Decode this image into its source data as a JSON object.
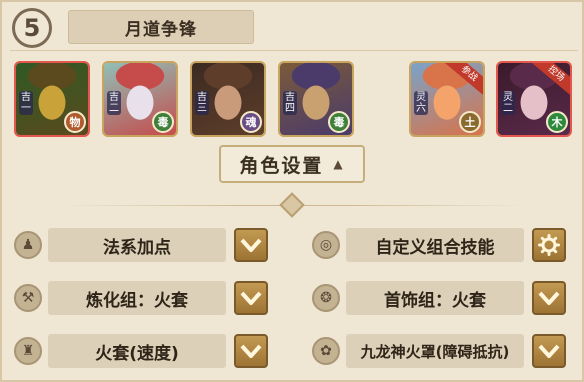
{
  "header": {
    "step_number": "5",
    "title": "月道争锋"
  },
  "heroes": [
    {
      "tag": "吉一",
      "element": "物",
      "element_color": "#b15a2e",
      "border": "red",
      "palette": [
        "#5a4a1e",
        "#c9a33a",
        "#2f5a24"
      ]
    },
    {
      "tag": "吉二",
      "element": "毒",
      "element_color": "#3f7f3a",
      "border": "gold",
      "palette": [
        "#c64b4b",
        "#e8e0ea",
        "#8fc0b7"
      ]
    },
    {
      "tag": "吉三",
      "element": "魂",
      "element_color": "#6b4d86",
      "border": "gold",
      "palette": [
        "#5e3e2a",
        "#c99b7a",
        "#3b2a22"
      ]
    },
    {
      "tag": "吉四",
      "element": "毒",
      "element_color": "#3f7f3a",
      "border": "gold",
      "palette": [
        "#4a3b6b",
        "#c9a070",
        "#7a5a3a"
      ]
    },
    {
      "tag": "灵六",
      "element": "土",
      "element_color": "#8a6a2e",
      "border": "gold",
      "corner": "参战",
      "palette": [
        "#d8734a",
        "#f4a36b",
        "#7aa3c9"
      ]
    },
    {
      "tag": "灵二",
      "element": "木",
      "element_color": "#2e8a3a",
      "border": "red",
      "corner": "控场",
      "palette": [
        "#5a2a4a",
        "#e6c0c8",
        "#3a1a2a"
      ]
    }
  ],
  "role_settings": {
    "label": "角色设置",
    "arrow": "▲"
  },
  "options_left": [
    {
      "icon": "attribute-icon",
      "icon_glyph": "♟",
      "label": "法系加点"
    },
    {
      "icon": "hammer-icon",
      "icon_glyph": "⚒",
      "label": "炼化组：火套"
    },
    {
      "icon": "armor-icon",
      "icon_glyph": "♜",
      "label": "火套(速度)"
    }
  ],
  "options_right": [
    {
      "icon": "swirl-icon",
      "icon_glyph": "◎",
      "label": "自定义组合技能",
      "button": "gear-icon"
    },
    {
      "icon": "jewelry-icon",
      "icon_glyph": "❂",
      "label": "首饰组：火套",
      "button": "chevron-down-icon"
    },
    {
      "icon": "lotus-icon",
      "icon_glyph": "✿",
      "label": "九龙神火罩(障碍抵抗)",
      "button": "chevron-down-icon"
    }
  ]
}
